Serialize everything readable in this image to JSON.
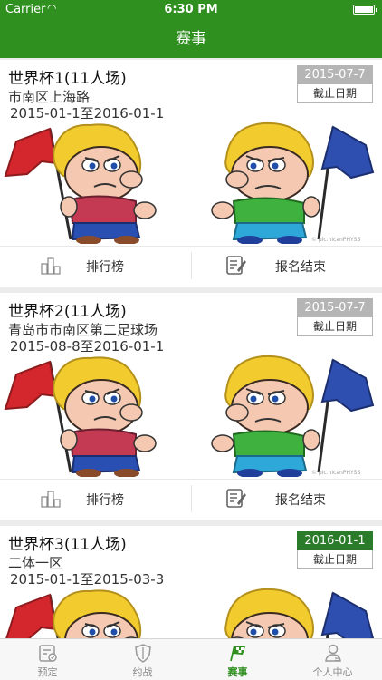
{
  "status": {
    "carrier": "Carrier",
    "time": "6:30 PM"
  },
  "nav": {
    "title": "赛事"
  },
  "events": [
    {
      "title": "世界杯1(11人场)",
      "place": "市南区上海路",
      "range": "2015-01-1至2016-01-1",
      "deadline_date": "2015-07-7",
      "deadline_label": "截止日期",
      "watermark": "© pic.nicanPHYSS"
    },
    {
      "title": "世界杯2(11人场)",
      "place": "青岛市市南区第二足球场",
      "range": "2015-08-8至2016-01-1",
      "deadline_date": "2015-07-7",
      "deadline_label": "截止日期",
      "watermark": "© pic.nicanPHYSS"
    },
    {
      "title": "世界杯3(11人场)",
      "place": "二体一区",
      "range": "2015-01-1至2015-03-3",
      "deadline_date": "2016-01-1",
      "deadline_label": "截止日期"
    }
  ],
  "actions": {
    "ranking": "排行榜",
    "signup_closed": "报名结束"
  },
  "tabs": [
    "预定",
    "约战",
    "赛事",
    "个人中心"
  ],
  "colors": {
    "brand_green": "#2f8f1f",
    "deadline_gray": "#b5b5b5",
    "deadline_green": "#2a7b2a"
  },
  "icons": [
    "wifi-icon",
    "battery-icon",
    "ranking-icon",
    "signup-icon",
    "booking-icon",
    "shield-icon",
    "race-flag-icon",
    "user-icon"
  ]
}
